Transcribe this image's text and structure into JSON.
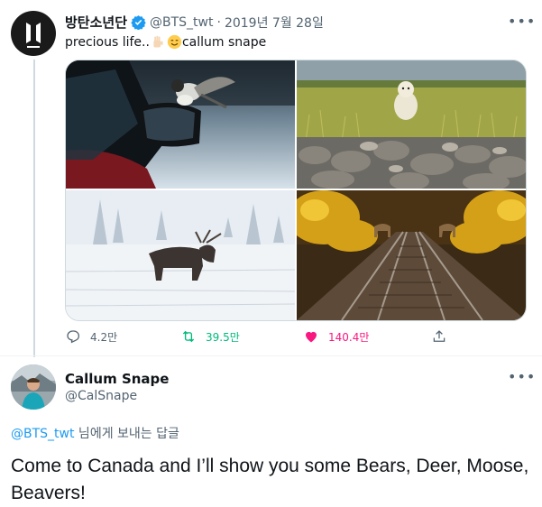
{
  "tweet": {
    "author_name": "방탄소년단",
    "handle": "@BTS_twt",
    "separator": "·",
    "date": "2019년 7월 28일",
    "text_prefix": "precious life..",
    "text_suffix": " callum snape",
    "more_label": "•••",
    "actions": {
      "replies": "4.2만",
      "retweets": "39.5만",
      "likes": "140.4만"
    },
    "colors": {
      "retweet": "#00ba7c",
      "like": "#f91880",
      "verified": "#1d9bf0"
    }
  },
  "reply": {
    "author_name": "Callum Snape",
    "handle": "@CalSnape",
    "more_label": "•••",
    "mention": "@BTS_twt",
    "reply_suffix": " 님에게 보내는 답글",
    "text": "Come to Canada and I’ll show you some Bears, Deer, Moose, Beavers!"
  },
  "icons": [
    "verified-badge-icon",
    "hand-emoji-icon",
    "smile-emoji-icon",
    "reply-icon",
    "retweet-icon",
    "heart-icon",
    "share-icon",
    "more-icon"
  ]
}
